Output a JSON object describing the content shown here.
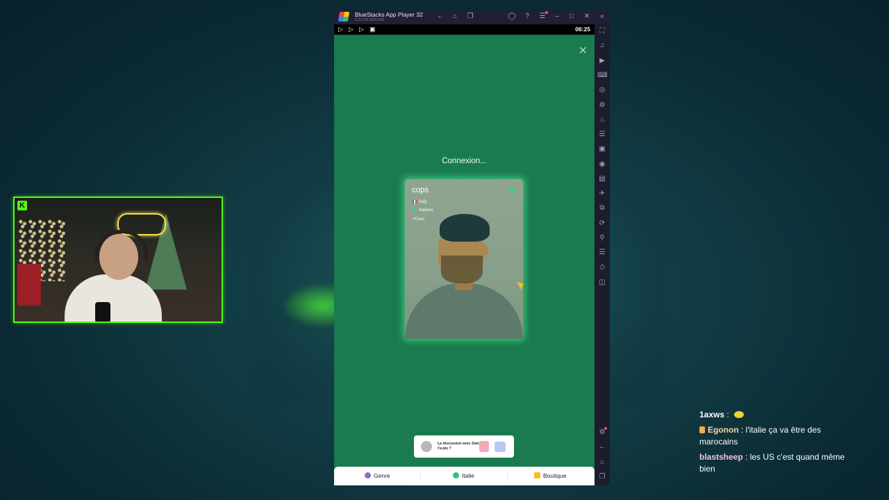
{
  "window": {
    "title": "BlueStacks App Player 32",
    "version": "5.22.150.1026 N32"
  },
  "statusbar": {
    "time": "06:25"
  },
  "app": {
    "connecting_text": "Connexion...",
    "card": {
      "name": "cops",
      "country": "Italy",
      "language": "Italiano",
      "tag": "#Ciao"
    },
    "toast": {
      "text": "La discussion avec Zain t'a plu ?"
    },
    "bottom_nav": [
      {
        "label": "Genre"
      },
      {
        "label": "Italie"
      },
      {
        "label": "Boutique"
      }
    ]
  },
  "chat": {
    "messages": [
      {
        "user": "1axws",
        "sep": " : ",
        "text": ""
      },
      {
        "user": "Egonon",
        "sep": " : ",
        "text": "l'italie ça va être des marocains"
      },
      {
        "user": "blastsheep",
        "sep": " : ",
        "text": "les US c'est quand même bien"
      }
    ]
  },
  "colors": {
    "app_bg": "#1a7a50",
    "kick_green": "#53fc18",
    "bluestacks_bg": "#1b1c2c"
  }
}
